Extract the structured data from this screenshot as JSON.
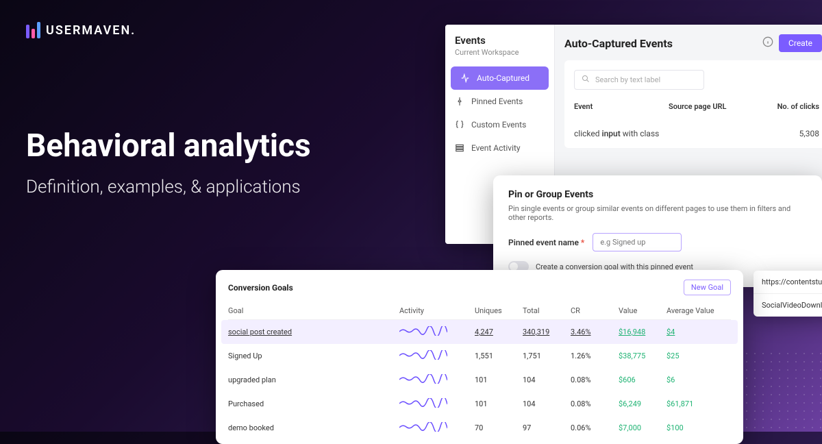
{
  "brand": {
    "name": "USERMAVEN."
  },
  "hero": {
    "title": "Behavioral analytics",
    "subtitle": "Definition, examples, & applications"
  },
  "events_panel": {
    "side_title": "Events",
    "side_subtitle": "Current Workspace",
    "side_items": [
      {
        "label": "Auto-Captured",
        "icon": "pulse-icon",
        "active": true
      },
      {
        "label": "Pinned Events",
        "icon": "pin-icon",
        "active": false
      },
      {
        "label": "Custom Events",
        "icon": "braces-icon",
        "active": false
      },
      {
        "label": "Event Activity",
        "icon": "list-icon",
        "active": false
      }
    ],
    "main_title": "Auto-Captured Events",
    "create_label": "Create",
    "search_placeholder": "Search by text label",
    "table_heads": {
      "event": "Event",
      "source": "Source page URL",
      "clicks": "No. of clicks"
    },
    "row": {
      "prefix": "clicked ",
      "element": "input",
      "suffix": " with class",
      "clicks": "5,308"
    }
  },
  "pin_panel": {
    "title": "Pin or Group Events",
    "desc": "Pin single events or group similar events on different pages to use them in filters and other reports.",
    "label": "Pinned event name",
    "required": "*",
    "placeholder": "e.g Signed up",
    "toggle_label": "Create a conversion goal with this pinned event"
  },
  "url_list": {
    "items": [
      "https://contentstudi",
      "SocialVideoDownlo"
    ]
  },
  "goals": {
    "title": "Conversion Goals",
    "new_goal_label": "New Goal",
    "heads": {
      "goal": "Goal",
      "activity": "Activity",
      "uniques": "Uniques",
      "total": "Total",
      "cr": "CR",
      "value": "Value",
      "avg": "Average Value"
    },
    "rows": [
      {
        "goal": "social post created",
        "uniques": "4,247",
        "total": "340,319",
        "cr": "3.46%",
        "value": "$16,948",
        "avg": "$4",
        "hl": true
      },
      {
        "goal": "Signed Up",
        "uniques": "1,551",
        "total": "1,751",
        "cr": "1.26%",
        "value": "$38,775",
        "avg": "$25",
        "hl": false
      },
      {
        "goal": "upgraded plan",
        "uniques": "101",
        "total": "104",
        "cr": "0.08%",
        "value": "$606",
        "avg": "$6",
        "hl": false
      },
      {
        "goal": "Purchased",
        "uniques": "101",
        "total": "104",
        "cr": "0.08%",
        "value": "$6,249",
        "avg": "$61,871",
        "hl": false
      },
      {
        "goal": "demo booked",
        "uniques": "70",
        "total": "97",
        "cr": "0.06%",
        "value": "$7,000",
        "avg": "$100",
        "hl": false
      }
    ]
  }
}
